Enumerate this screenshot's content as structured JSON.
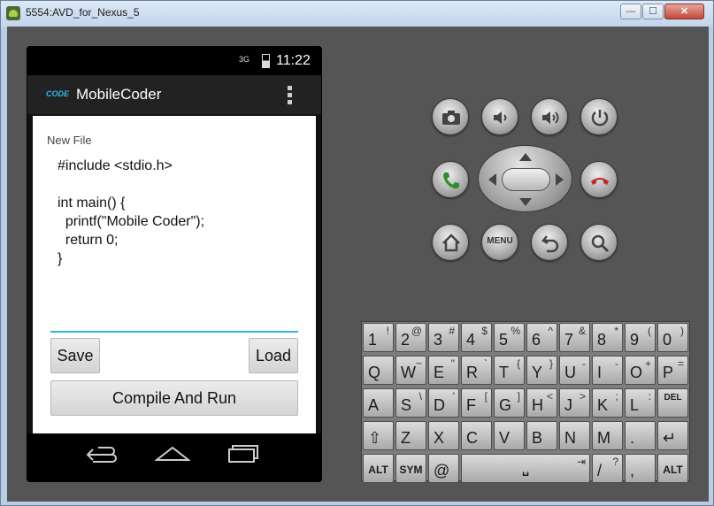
{
  "window": {
    "title": "5554:AVD_for_Nexus_5",
    "min_glyph": "—",
    "max_glyph": "☐",
    "close_glyph": "✕"
  },
  "status_bar": {
    "signal": "3G",
    "time": "11:22"
  },
  "action_bar": {
    "logo": "CODE",
    "title": "MobileCoder"
  },
  "screen": {
    "file_label": "New File",
    "code": "#include <stdio.h>\n\nint main() {\n  printf(\"Mobile Coder\");\n  return 0;\n}",
    "save_label": "Save",
    "load_label": "Load",
    "run_label": "Compile And Run"
  },
  "controls": {
    "menu_label": "MENU",
    "camera_icon": "camera-icon",
    "vol_down_icon": "volume-down-icon",
    "vol_up_icon": "volume-up-icon",
    "power_icon": "power-icon",
    "call_icon": "call-icon",
    "end_call_icon": "end-call-icon",
    "home_icon": "home-icon",
    "back_icon": "back-icon",
    "search_icon": "search-icon"
  },
  "keyboard": {
    "rows": [
      [
        [
          "1",
          "!"
        ],
        [
          "2",
          "@"
        ],
        [
          "3",
          "#"
        ],
        [
          "4",
          "$"
        ],
        [
          "5",
          "%"
        ],
        [
          "6",
          "^"
        ],
        [
          "7",
          "&"
        ],
        [
          "8",
          "*"
        ],
        [
          "9",
          "("
        ],
        [
          "0",
          ")"
        ]
      ],
      [
        [
          "Q",
          ""
        ],
        [
          "W",
          "~"
        ],
        [
          "E",
          "\""
        ],
        [
          "R",
          "`"
        ],
        [
          "T",
          "{"
        ],
        [
          "Y",
          "}"
        ],
        [
          "U",
          "-"
        ],
        [
          "I",
          "-"
        ],
        [
          "O",
          "+"
        ],
        [
          "P",
          "="
        ]
      ],
      [
        [
          "A",
          ""
        ],
        [
          "S",
          "\\"
        ],
        [
          "D",
          "'"
        ],
        [
          "F",
          "["
        ],
        [
          "G",
          "]"
        ],
        [
          "H",
          "<"
        ],
        [
          "J",
          ">"
        ],
        [
          "K",
          ";"
        ],
        [
          "L",
          ":"
        ],
        [
          "DEL",
          ""
        ]
      ],
      [
        [
          "⇧",
          ""
        ],
        [
          "Z",
          ""
        ],
        [
          "X",
          ""
        ],
        [
          "C",
          ""
        ],
        [
          "V",
          ""
        ],
        [
          "B",
          ""
        ],
        [
          "N",
          ""
        ],
        [
          "M",
          ""
        ],
        [
          ".",
          ""
        ],
        [
          "↵",
          ""
        ]
      ]
    ],
    "bottom": {
      "alt_left": "ALT",
      "sym": "SYM",
      "at": "@",
      "space": "␣",
      "tab_glyph": "⇥",
      "slash": "/",
      "slash_sub": "?",
      "comma": ",",
      "alt_right": "ALT"
    }
  },
  "colors": {
    "accent": "#33b5e5",
    "call_green": "#2e8b2e",
    "end_red": "#c62828"
  }
}
